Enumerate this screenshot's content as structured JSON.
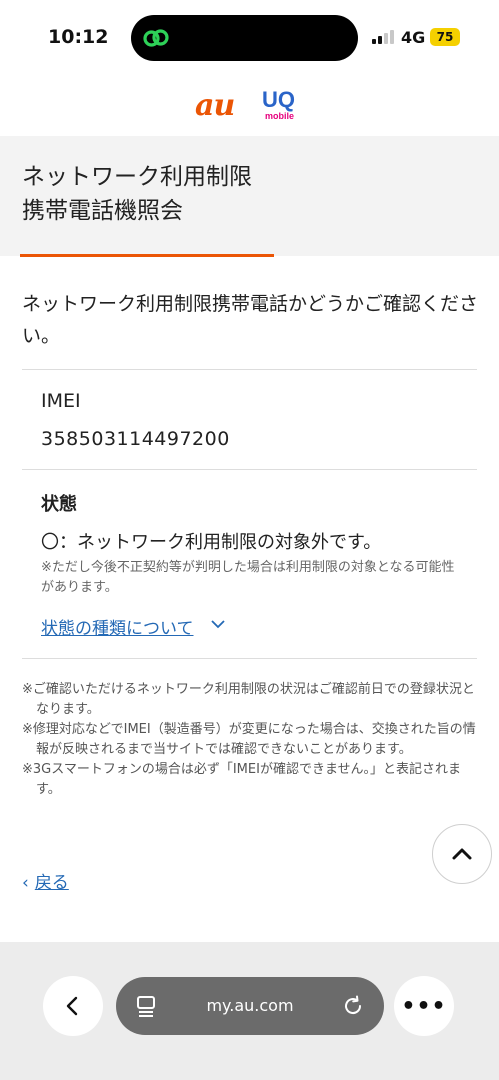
{
  "status_bar": {
    "time": "10:12",
    "network": "4G",
    "battery": "75",
    "battery_color": "#f5d000"
  },
  "header": {
    "au_logo": "au",
    "uq_logo_main": "UQ",
    "uq_logo_sub": "mobile",
    "brand_color": "#eb5505"
  },
  "page": {
    "title_line1": "ネットワーク利用制限",
    "title_line2": "携帯電話機照会",
    "intro": "ネットワーク利用制限携帯電話かどうかご確認ください。"
  },
  "imei": {
    "label": "IMEI",
    "value": "358503114497200"
  },
  "status": {
    "label": "状態",
    "value": "〇：ネットワーク利用制限の対象外です。",
    "note": "※ただし今後不正契約等が判明した場合は利用制限の対象となる可能性があります。",
    "link": "状態の種類について"
  },
  "notes": [
    "※ご確認いただけるネットワーク利用制限の状況はご確認前日での登録状況となります。",
    "※修理対応などでIMEI（製造番号）が変更になった場合は、交換された旨の情報が反映されるまで当サイトでは確認できないことがあります。",
    "※3Gスマートフォンの場合は必ず「IMEIが確認できません。」と表記されます。"
  ],
  "back": {
    "label": "戻る"
  },
  "browser": {
    "url": "my.au.com",
    "more": "•••"
  },
  "icons": {
    "island": "link-icon",
    "scroll_top": "chevron-up-icon",
    "back": "chevron-left-icon",
    "tabs": "tabs-icon",
    "reload": "reload-icon"
  },
  "colors": {
    "link": "#2469b5",
    "island_icon": "#2ed158"
  }
}
